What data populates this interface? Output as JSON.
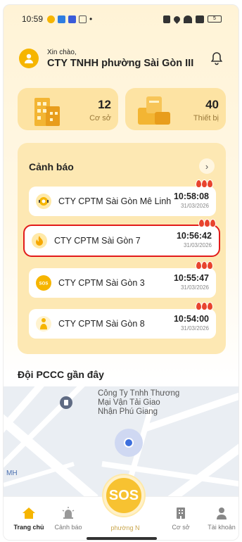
{
  "status_bar": {
    "time": "10:59",
    "dot": "•",
    "battery": "5"
  },
  "header": {
    "greeting": "Xin chào,",
    "company": "CTY TNHH phường Sài Gòn III"
  },
  "stats": [
    {
      "value": "12",
      "label": "Cơ sở"
    },
    {
      "value": "40",
      "label": "Thiết bị"
    }
  ],
  "alerts": {
    "title": "Cảnh báo",
    "arrow": "›",
    "items": [
      {
        "name": "CTY CPTM Sài Gòn Mê Linh",
        "time": "10:58:08",
        "date": "31/03/2026",
        "icon": "alarm-bell-icon",
        "color": "#f6b500"
      },
      {
        "name": "CTY CPTM Sài Gòn 7",
        "time": "10:56:42",
        "date": "31/03/2026",
        "icon": "flame-icon",
        "color": "#f6b500"
      },
      {
        "name": "CTY CPTM Sài Gòn 3",
        "time": "10:55:47",
        "date": "31/03/2026",
        "icon": "sos-icon",
        "color": "#f6b500"
      },
      {
        "name": "CTY CPTM Sài Gòn 8",
        "time": "10:54:00",
        "date": "31/03/2026",
        "icon": "person-icon",
        "color": "#f6b500"
      }
    ]
  },
  "pccc": {
    "title": "Đội PCCC gần đây"
  },
  "map": {
    "place_line1": "Công Ty Tnhh Thương",
    "place_line2": "Mại Vận Tải Giao",
    "place_line3": "Nhận Phú Giang",
    "edge_label": "MH"
  },
  "nav": {
    "home": "Trang chủ",
    "alerts": "Cảnh báo",
    "sos": "SOS",
    "sos_sub": "phường N",
    "facilities": "Cơ sở",
    "account": "Tài khoản"
  },
  "colors": {
    "accent": "#f6b500",
    "selected_border": "#e21b1b"
  }
}
